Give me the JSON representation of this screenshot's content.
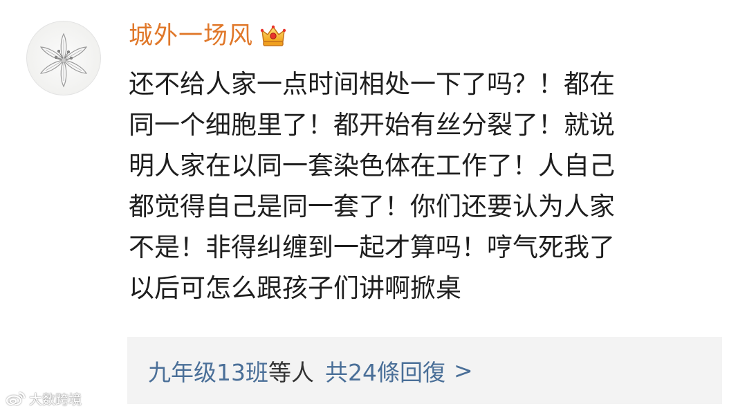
{
  "comment": {
    "username": "城外一场风",
    "badge_icon": "crown-icon",
    "lines": [
      "还不给人家一点时间相处一下了吗？！都在",
      "同一个细胞里了！都开始有丝分裂了！就说",
      "明人家在以同一套染色体在工作了！人自己",
      "都觉得自己是同一套了！你们还要认为人家",
      "不是！非得纠缠到一起才算吗！哼气死我了",
      "以后可怎么跟孩子们讲啊掀桌"
    ]
  },
  "replies": {
    "names": "九年级13班",
    "suffix": "等人",
    "count_label": "共24條回復",
    "chevron": ">"
  },
  "watermark": {
    "icon": "weibo-logo-icon",
    "text": "大数跨境"
  },
  "colors": {
    "username": "#e0782a",
    "text": "#1e1e1e",
    "link": "#4a6f98",
    "reply_bg": "#f3f3f3"
  }
}
